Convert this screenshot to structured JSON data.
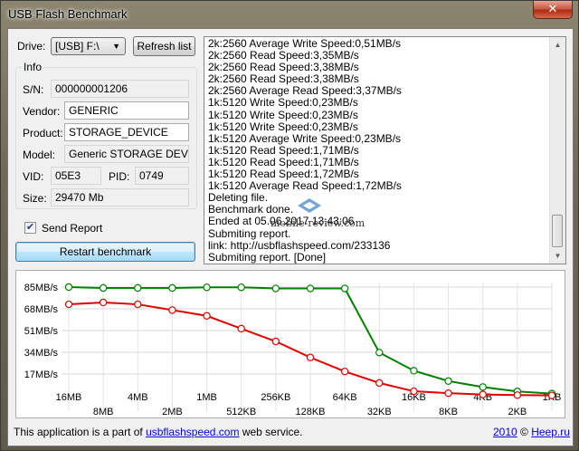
{
  "window": {
    "title": "USB Flash Benchmark",
    "close_label": "✕"
  },
  "drive": {
    "label": "Drive:",
    "value": "[USB] F:\\",
    "refresh_label": "Refresh list"
  },
  "info": {
    "group_label": "Info",
    "sn_label": "S/N:",
    "sn_value": "000000001206",
    "vendor_label": "Vendor:",
    "vendor_value": "GENERIC",
    "product_label": "Product:",
    "product_value": "STORAGE_DEVICE",
    "model_label": "Model:",
    "model_value": "Generic STORAGE DEVICE",
    "vid_label": "VID:",
    "vid_value": "05E3",
    "pid_label": "PID:",
    "pid_value": "0749",
    "size_label": "Size:",
    "size_value": "29470 Mb"
  },
  "send_report": {
    "label": "Send Report",
    "checked": true
  },
  "restart_label": "Restart benchmark",
  "log": [
    "2k:2560 Average Write Speed:0,51MB/s",
    "2k:2560 Read Speed:3,35MB/s",
    "2k:2560 Read Speed:3,38MB/s",
    "2k:2560 Read Speed:3,38MB/s",
    "2k:2560 Average Read Speed:3,37MB/s",
    "1k:5120 Write Speed:0,23MB/s",
    "1k:5120 Write Speed:0,23MB/s",
    "1k:5120 Write Speed:0,23MB/s",
    "1k:5120 Average Write Speed:0,23MB/s",
    "1k:5120 Read Speed:1,71MB/s",
    "1k:5120 Read Speed:1,71MB/s",
    "1k:5120 Read Speed:1,72MB/s",
    "1k:5120 Average Read Speed:1,72MB/s",
    "Deleting file.",
    "Benchmark done.",
    "Ended at 05.06.2017 13:43:06",
    "Submiting report.",
    "link: http://usbflashspeed.com/233136",
    "Submiting report. [Done]"
  ],
  "watermark": "mobile-review.com",
  "footer": {
    "prefix": "This application is a part of ",
    "link": "usbflashspeed.com",
    "suffix": " web service.",
    "year": "2010",
    "copyright": " © ",
    "heep": "Heep.ru"
  },
  "colors": {
    "read": "#008000",
    "write": "#e00000"
  },
  "chart_data": {
    "type": "line",
    "x_upper": [
      "16MB",
      "4MB",
      "1MB",
      "256KB",
      "64KB",
      "16KB",
      "4KB",
      "1KB"
    ],
    "x_lower": [
      "8MB",
      "2MB",
      "512KB",
      "128KB",
      "32KB",
      "8KB",
      "2KB"
    ],
    "categories": [
      "16MB",
      "8MB",
      "4MB",
      "2MB",
      "1MB",
      "512KB",
      "256KB",
      "128KB",
      "64KB",
      "32KB",
      "16KB",
      "8KB",
      "4KB",
      "2KB",
      "1KB"
    ],
    "yticks": [
      "85MB/s",
      "68MB/s",
      "51MB/s",
      "34MB/s",
      "17MB/s"
    ],
    "ytick_values": [
      85,
      68,
      51,
      34,
      17
    ],
    "ylim": [
      0,
      85
    ],
    "grid": true,
    "series": [
      {
        "values": [
          85.0,
          84.3,
          84.3,
          84.3,
          84.8,
          84.8,
          83.9,
          83.9,
          83.9,
          33.8,
          19.6,
          11.5,
          6.8,
          3.4,
          1.7
        ]
      },
      {
        "values": [
          71.5,
          73.0,
          71.5,
          67.0,
          62.5,
          52.5,
          42.5,
          30.0,
          19.0,
          10.0,
          3.5,
          2.0,
          1.0,
          0.5,
          0.23
        ]
      }
    ]
  }
}
